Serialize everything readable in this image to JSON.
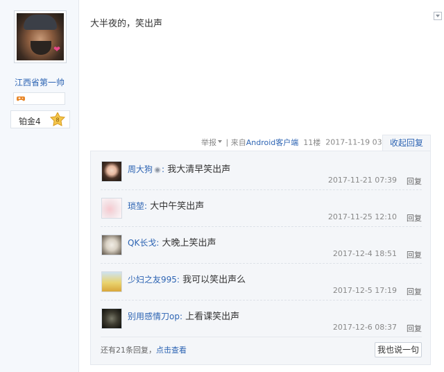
{
  "author": {
    "name": "江西省第一帅",
    "level_name": "铂金4",
    "level_badge_value": "8",
    "avatar_icon": "user-avatar-icon",
    "badge_icon": "gamepad-icon"
  },
  "post": {
    "text": "大半夜的，笑出声",
    "report_label": "举报",
    "separator": "|",
    "source_prefix": "来自",
    "source_client": "Android客户端",
    "floor": "11楼",
    "time": "2017-11-19 03:40",
    "collapse_label": "收起回复"
  },
  "replies": [
    {
      "name": "周大狗",
      "colon": ":",
      "content": "我大清早笑出声",
      "time": "2017-11-21 07:39",
      "reply_label": "回复",
      "has_vip_icon": true
    },
    {
      "name": "琐堃",
      "colon": ":",
      "content": "大中午笑出声",
      "time": "2017-11-25 12:10",
      "reply_label": "回复"
    },
    {
      "name": "QK长戈",
      "colon": ":",
      "content": "大晚上笑出声",
      "time": "2017-12-4 18:51",
      "reply_label": "回复"
    },
    {
      "name": "少妇之友995",
      "colon": ":",
      "content": "我可以笑出声么",
      "time": "2017-12-5 17:19",
      "reply_label": "回复"
    },
    {
      "name": "别用感情刀op",
      "colon": ":",
      "content": "上看课笑出声",
      "time": "2017-12-6 08:37",
      "reply_label": "回复"
    }
  ],
  "footer": {
    "more_prefix": "还有21条回复，",
    "more_link": "点击查看",
    "say_button": "我也说一句"
  },
  "colors": {
    "link": "#2d64b3",
    "sidebar_bg": "#f5f8fc",
    "reply_bg": "#f4f6f9"
  }
}
